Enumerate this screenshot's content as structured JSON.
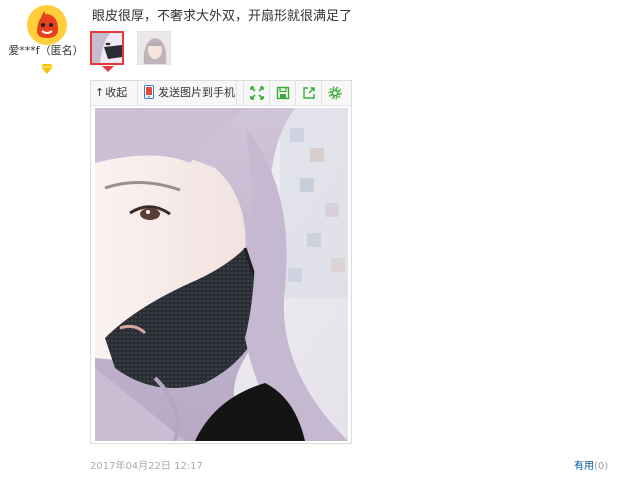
{
  "review": {
    "username": "爱***f（匿名）",
    "text": "眼皮很厚，不奢求大外双，开扇形就很满足了",
    "date": "2017年04月22日 12:17",
    "useful_label": "有用",
    "useful_count": "(0)"
  },
  "viewer": {
    "collapse_label": "收起",
    "collapse_arrow": "↑",
    "send_to_phone_label": "发送图片到手机",
    "tools": [
      "expand-icon",
      "save-icon",
      "share-icon",
      "settings-icon"
    ]
  },
  "colors": {
    "accent_red": "#e4393c",
    "tool_green": "#3aaa35",
    "link_blue": "#005aa0",
    "meta_gray": "#aaaaaa"
  }
}
